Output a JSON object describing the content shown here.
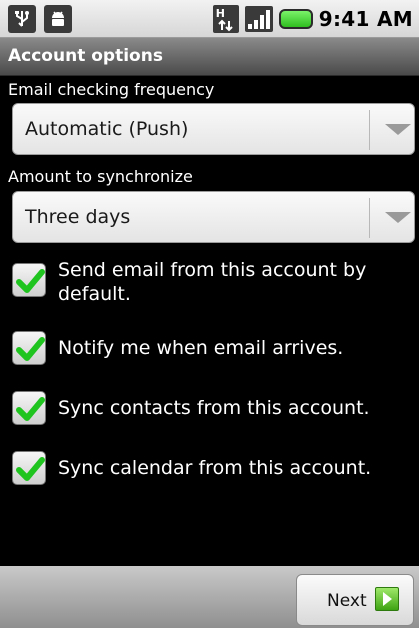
{
  "status_bar": {
    "time": "9:41 AM",
    "icons": [
      "usb-icon",
      "android-debug-icon",
      "h-data-icon",
      "signal-icon",
      "battery-icon"
    ]
  },
  "title_bar": {
    "title": "Account options"
  },
  "email_frequency": {
    "label": "Email checking frequency",
    "value": "Automatic (Push)"
  },
  "sync_amount": {
    "label": "Amount to synchronize",
    "value": "Three days"
  },
  "checkboxes": [
    {
      "label": "Send email from this account by default.",
      "checked": true
    },
    {
      "label": "Notify me when email arrives.",
      "checked": true
    },
    {
      "label": "Sync contacts from this account.",
      "checked": true
    },
    {
      "label": "Sync calendar from this account.",
      "checked": true
    }
  ],
  "footer": {
    "next_label": "Next"
  },
  "colors": {
    "check": "#1fc41f",
    "title_bar": "#5a5a5a",
    "background": "#000000"
  }
}
